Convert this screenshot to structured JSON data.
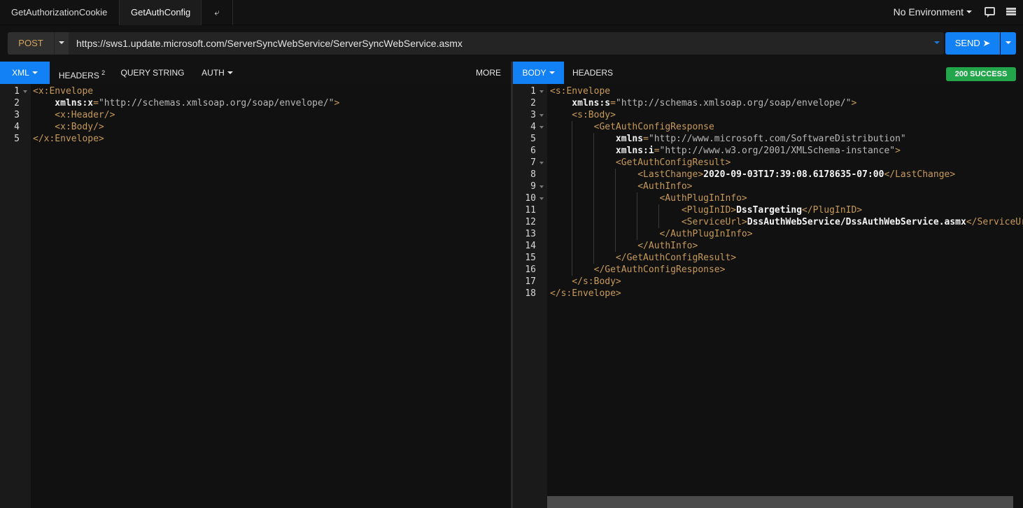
{
  "top_tabs": [
    "GetAuthorizationCookie",
    "GetAuthConfig",
    "⤶"
  ],
  "environment": "No Environment",
  "request": {
    "method": "POST",
    "url": "https://sws1.update.microsoft.com/ServerSyncWebService/ServerSyncWebService.asmx",
    "send_label": "SEND ➤"
  },
  "request_tabs": {
    "xml": "XML",
    "headers": "HEADERS",
    "headers_count": "2",
    "query": "QUERY STRING",
    "auth": "AUTH",
    "more": "MORE"
  },
  "response_tabs": {
    "body": "BODY",
    "headers": "HEADERS",
    "status": "200 SUCCESS"
  },
  "request_body": [
    {
      "n": "1",
      "parts": [
        [
          "t",
          "<x:Envelope"
        ]
      ]
    },
    {
      "n": "2",
      "parts": [
        [
          "a",
          "    xmlns:x"
        ],
        [
          "t",
          "="
        ],
        [
          "s",
          "\"http://schemas.xmlsoap.org/soap/envelope/\""
        ],
        [
          "t",
          ">"
        ]
      ]
    },
    {
      "n": "3",
      "parts": [
        [
          "t",
          "    <x:Header/>"
        ]
      ]
    },
    {
      "n": "4",
      "parts": [
        [
          "t",
          "    <x:Body/>"
        ]
      ]
    },
    {
      "n": "5",
      "parts": [
        [
          "t",
          "</x:Envelope>"
        ]
      ]
    }
  ],
  "response_body": [
    {
      "n": "1",
      "parts": [
        [
          "t",
          "<s:Envelope"
        ]
      ]
    },
    {
      "n": "2",
      "parts": [
        [
          "a",
          "    xmlns:s"
        ],
        [
          "t",
          "="
        ],
        [
          "s",
          "\"http://schemas.xmlsoap.org/soap/envelope/\""
        ],
        [
          "t",
          ">"
        ]
      ]
    },
    {
      "n": "3",
      "parts": [
        [
          "t",
          "    <s:Body>"
        ]
      ]
    },
    {
      "n": "4",
      "parts": [
        [
          "t",
          "        <GetAuthConfigResponse"
        ]
      ]
    },
    {
      "n": "5",
      "parts": [
        [
          "a",
          "            xmlns"
        ],
        [
          "t",
          "="
        ],
        [
          "s",
          "\"http://www.microsoft.com/SoftwareDistribution\""
        ]
      ]
    },
    {
      "n": "6",
      "parts": [
        [
          "a",
          "            xmlns:i"
        ],
        [
          "t",
          "="
        ],
        [
          "s",
          "\"http://www.w3.org/2001/XMLSchema-instance\""
        ],
        [
          "t",
          ">"
        ]
      ]
    },
    {
      "n": "7",
      "parts": [
        [
          "t",
          "            <GetAuthConfigResult>"
        ]
      ]
    },
    {
      "n": "8",
      "parts": [
        [
          "t",
          "                <LastChange>"
        ],
        [
          "x",
          "2020-09-03T17:39:08.6178635-07:00"
        ],
        [
          "t",
          "</LastChange>"
        ]
      ]
    },
    {
      "n": "9",
      "parts": [
        [
          "t",
          "                <AuthInfo>"
        ]
      ]
    },
    {
      "n": "10",
      "parts": [
        [
          "t",
          "                    <AuthPlugInInfo>"
        ]
      ]
    },
    {
      "n": "11",
      "parts": [
        [
          "t",
          "                        <PlugInID>"
        ],
        [
          "x",
          "DssTargeting"
        ],
        [
          "t",
          "</PlugInID>"
        ]
      ]
    },
    {
      "n": "12",
      "parts": [
        [
          "t",
          "                        <ServiceUrl>"
        ],
        [
          "x",
          "DssAuthWebService/DssAuthWebService.asmx"
        ],
        [
          "t",
          "</ServiceUrl>"
        ]
      ]
    },
    {
      "n": "13",
      "parts": [
        [
          "t",
          "                    </AuthPlugInInfo>"
        ]
      ]
    },
    {
      "n": "14",
      "parts": [
        [
          "t",
          "                </AuthInfo>"
        ]
      ]
    },
    {
      "n": "15",
      "parts": [
        [
          "t",
          "            </GetAuthConfigResult>"
        ]
      ]
    },
    {
      "n": "16",
      "parts": [
        [
          "t",
          "        </GetAuthConfigResponse>"
        ]
      ]
    },
    {
      "n": "17",
      "parts": [
        [
          "t",
          "    </s:Body>"
        ]
      ]
    },
    {
      "n": "18",
      "parts": [
        [
          "t",
          "</s:Envelope>"
        ]
      ]
    }
  ],
  "colors": {
    "accent": "#1281f5",
    "success": "#23a54b",
    "tag": "#c79a5a",
    "method": "#d4a65a"
  }
}
